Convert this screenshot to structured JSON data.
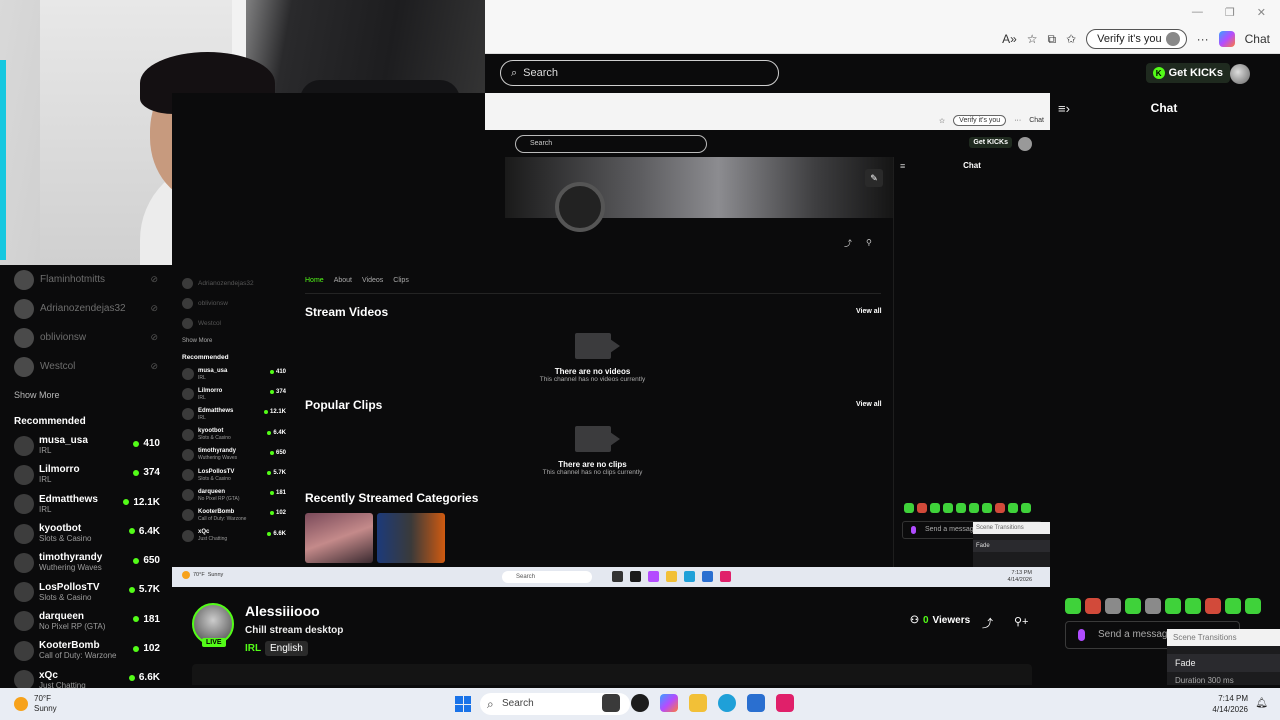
{
  "browser": {
    "verify_label": "Verify it's you",
    "chat_label": "Chat",
    "window_controls": [
      "—",
      "❐",
      "✕"
    ]
  },
  "header": {
    "search_placeholder": "Search",
    "get_kicks_label": "Get KICKs"
  },
  "sidebar": {
    "following": [
      {
        "name": "Flaminhotmitts"
      },
      {
        "name": "Adrianozendejas32"
      },
      {
        "name": "oblivionsw"
      },
      {
        "name": "Westcol"
      }
    ],
    "show_more": "Show More",
    "recommended_title": "Recommended",
    "recommended": [
      {
        "name": "musa_usa",
        "category": "IRL",
        "viewers": "410"
      },
      {
        "name": "Lilmorro",
        "category": "IRL",
        "viewers": "374"
      },
      {
        "name": "Edmatthews",
        "category": "IRL",
        "viewers": "12.1K"
      },
      {
        "name": "kyootbot",
        "category": "Slots & Casino",
        "viewers": "6.4K"
      },
      {
        "name": "timothyrandy",
        "category": "Wuthering Waves",
        "viewers": "650"
      },
      {
        "name": "LosPollosTV",
        "category": "Slots & Casino",
        "viewers": "5.7K"
      },
      {
        "name": "darqueen",
        "category": "No Pixel RP (GTA)",
        "viewers": "181"
      },
      {
        "name": "KooterBomb",
        "category": "Call of Duty: Warzone",
        "viewers": "102"
      },
      {
        "name": "xQc",
        "category": "Just Chatting",
        "viewers": "6.6K"
      }
    ]
  },
  "stream": {
    "inner_search": "Search",
    "inner_get_kicks": "Get KICKs",
    "inner_verify": "Verify it's you",
    "inner_chat_label": "Chat",
    "inner_chat_title": "Chat",
    "tabs": [
      "Home",
      "About",
      "Videos",
      "Clips"
    ],
    "stream_videos_title": "Stream Videos",
    "view_all": "View all",
    "no_videos": "There are no videos",
    "no_videos_sub": "This channel has no videos currently",
    "popular_clips_title": "Popular Clips",
    "no_clips": "There are no clips",
    "no_clips_sub": "This channel has no clips currently",
    "recent_categories_title": "Recently Streamed Categories",
    "inner_send": "Send a message",
    "inner_scene_header": "Scene Transitions",
    "inner_scene_fade": "Fade",
    "inner_left_following": [
      "Adrianozendejas32",
      "oblivionsw",
      "Westcol"
    ],
    "inner_show_more": "Show More",
    "inner_recommended": "Recommended",
    "inner_taskbar": {
      "temp": "70°F",
      "cond": "Sunny",
      "search": "Search",
      "time": "7:13 PM",
      "date": "4/14/2026"
    }
  },
  "chat": {
    "title": "Chat",
    "send_placeholder": "Send a message",
    "scene_header": "Scene Transitions",
    "scene_fade": "Fade",
    "scene_duration": "Duration",
    "scene_ms": "300 ms"
  },
  "channel": {
    "name": "Alessiiiooo",
    "title": "Chill stream desktop",
    "category": "IRL",
    "language": "English",
    "live": "LIVE",
    "viewers_count": "0",
    "viewers_label": "Viewers"
  },
  "taskbar": {
    "temp": "70°F",
    "cond": "Sunny",
    "search": "Search",
    "time": "7:14 PM",
    "date": "4/14/2026"
  },
  "colors": {
    "accent": "#53fc18",
    "background": "#0b0b0c"
  }
}
